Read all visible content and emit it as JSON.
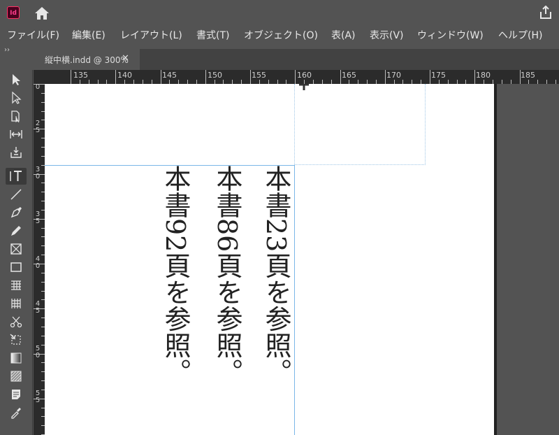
{
  "app": {
    "logo_text": "Id"
  },
  "menu": [
    "ファイル(F)",
    "編集(E)",
    "レイアウト(L)",
    "書式(T)",
    "オブジェクト(O)",
    "表(A)",
    "表示(V)",
    "ウィンドウ(W)",
    "ヘルプ(H)"
  ],
  "panel": {
    "collapse": "››"
  },
  "tab": {
    "title": "縦中横.indd @ 300%",
    "close": "✕"
  },
  "ruler": {
    "h_labels": [
      "135",
      "140",
      "145",
      "150",
      "155",
      "160",
      "165",
      "170",
      "175",
      "180",
      "185"
    ],
    "v_labels": [
      "0",
      "2\n5",
      "3\n0",
      "3\n5",
      "4\n0",
      "4\n5",
      "5\n0",
      "5\n5"
    ]
  },
  "text_columns": [
    "本書23頁を参照。",
    "本書86頁を参照。",
    "本書92頁を参照。"
  ],
  "colors": {
    "frame": "#7ab7e8",
    "accent": "#ff3366"
  }
}
